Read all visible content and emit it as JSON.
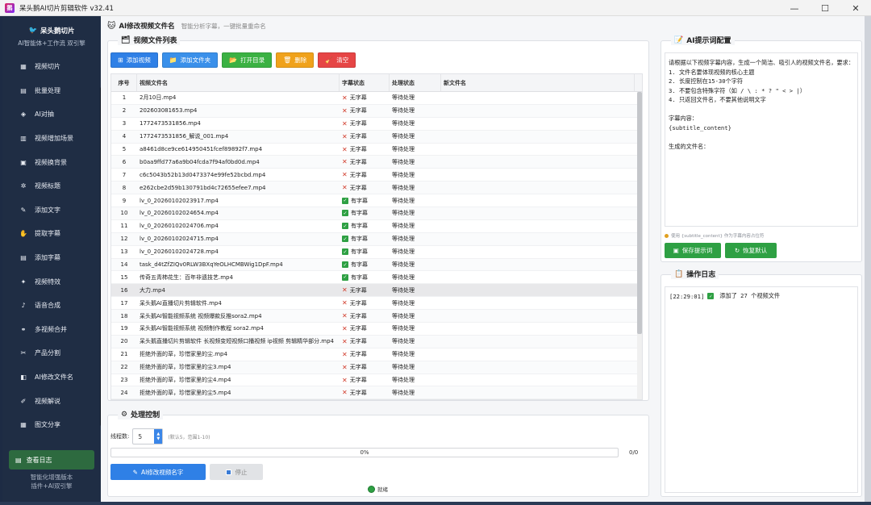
{
  "window": {
    "title": "呆头鹅AI切片剪辑软件 v32.41",
    "icon": "app-logo-icon",
    "minimize": "—",
    "maximize": "☐",
    "close": "✕"
  },
  "sidebar": {
    "brand_title": "呆头鹅切片",
    "brand_sub": "AI智能体+工作流 双引擎",
    "items": [
      {
        "label": "视频切片",
        "icon": "film-icon",
        "glyph": "▦"
      },
      {
        "label": "批量处理",
        "icon": "box-icon",
        "glyph": "▤"
      },
      {
        "label": "AI对抽",
        "icon": "ai-icon",
        "glyph": "◈"
      },
      {
        "label": "视频增加场景",
        "icon": "scene-icon",
        "glyph": "▥"
      },
      {
        "label": "视频换背景",
        "icon": "image-icon",
        "glyph": "▣"
      },
      {
        "label": "视频标题",
        "icon": "star-icon",
        "glyph": "✲"
      },
      {
        "label": "添加文字",
        "icon": "pen-icon",
        "glyph": "✎"
      },
      {
        "label": "提取字幕",
        "icon": "hand-icon",
        "glyph": "✋"
      },
      {
        "label": "添加字幕",
        "icon": "note-icon",
        "glyph": "▤"
      },
      {
        "label": "视频特效",
        "icon": "magic-icon",
        "glyph": "✦"
      },
      {
        "label": "语音合成",
        "icon": "mic-icon",
        "glyph": "♪"
      },
      {
        "label": "多视频合并",
        "icon": "link-icon",
        "glyph": "⚭"
      },
      {
        "label": "产品分割",
        "icon": "scissors-icon",
        "glyph": "✂"
      },
      {
        "label": "AI修改文件名",
        "icon": "rename-icon",
        "glyph": "◧"
      },
      {
        "label": "视频解说",
        "icon": "comment-icon",
        "glyph": "✐"
      },
      {
        "label": "图文分享",
        "icon": "share-icon",
        "glyph": "▦"
      }
    ],
    "log_button": "查看日志",
    "footer_line1": "智能化增强版本",
    "footer_line2": "插件+AI双引擎"
  },
  "header": {
    "title": "AI修改视频文件名",
    "subtitle": "智能分析字幕，一键批量重命名"
  },
  "files_panel": {
    "title": "视频文件列表",
    "buttons": {
      "add_video": "添加视频",
      "add_folder": "添加文件夹",
      "open_dir": "打开目录",
      "delete": "删除",
      "clear": "清空"
    },
    "columns": [
      "序号",
      "视频文件名",
      "字幕状态",
      "处理状态",
      "新文件名"
    ],
    "rows": [
      {
        "no": "1",
        "name": "2月10日.mp4",
        "sub": "无字幕",
        "has": false,
        "status": "等待处理"
      },
      {
        "no": "2",
        "name": "202603081653.mp4",
        "sub": "无字幕",
        "has": false,
        "status": "等待处理"
      },
      {
        "no": "3",
        "name": "1772473531856.mp4",
        "sub": "无字幕",
        "has": false,
        "status": "等待处理"
      },
      {
        "no": "4",
        "name": "1772473531856_解说_001.mp4",
        "sub": "无字幕",
        "has": false,
        "status": "等待处理"
      },
      {
        "no": "5",
        "name": "a8461d8ce9ce614950451fcef89892f7.mp4",
        "sub": "无字幕",
        "has": false,
        "status": "等待处理"
      },
      {
        "no": "6",
        "name": "b0aa9ffd77a6a9b04fcda7f94af0bd0d.mp4",
        "sub": "无字幕",
        "has": false,
        "status": "等待处理"
      },
      {
        "no": "7",
        "name": "c6c5043b52b13d0473374e99fe52bcbd.mp4",
        "sub": "无字幕",
        "has": false,
        "status": "等待处理"
      },
      {
        "no": "8",
        "name": "e262cbe2d59b130791bd4c72655efee7.mp4",
        "sub": "无字幕",
        "has": false,
        "status": "等待处理"
      },
      {
        "no": "9",
        "name": "lv_0_20260102023917.mp4",
        "sub": "有字幕",
        "has": true,
        "status": "等待处理"
      },
      {
        "no": "10",
        "name": "lv_0_20260102024654.mp4",
        "sub": "有字幕",
        "has": true,
        "status": "等待处理"
      },
      {
        "no": "11",
        "name": "lv_0_20260102024706.mp4",
        "sub": "有字幕",
        "has": true,
        "status": "等待处理"
      },
      {
        "no": "12",
        "name": "lv_0_20260102024715.mp4",
        "sub": "有字幕",
        "has": true,
        "status": "等待处理"
      },
      {
        "no": "13",
        "name": "lv_0_20260102024728.mp4",
        "sub": "有字幕",
        "has": true,
        "status": "等待处理"
      },
      {
        "no": "14",
        "name": "task_d4tZfZIQv0RLW3BXqYeOLHCMBWig1DpF.mp4",
        "sub": "有字幕",
        "has": true,
        "status": "等待处理"
      },
      {
        "no": "15",
        "name": "传奇五青柿花生：百年非遗技艺.mp4",
        "sub": "有字幕",
        "has": true,
        "status": "等待处理"
      },
      {
        "no": "16",
        "name": "大力.mp4",
        "sub": "无字幕",
        "has": false,
        "status": "等待处理"
      },
      {
        "no": "17",
        "name": "呆头鹅AI直播切片剪辑软件.mp4",
        "sub": "无字幕",
        "has": false,
        "status": "等待处理"
      },
      {
        "no": "18",
        "name": "呆头鹅AI智能视频系统 视频爆款反推sora2.mp4",
        "sub": "无字幕",
        "has": false,
        "status": "等待处理"
      },
      {
        "no": "19",
        "name": "呆头鹅AI智能视频系统 视频制作教程 sora2.mp4",
        "sub": "无字幕",
        "has": false,
        "status": "等待处理"
      },
      {
        "no": "20",
        "name": "呆头鹅直播切片剪辑软件 长视频变短视频口播视频 ip视频 剪辑精华部分.mp4",
        "sub": "无字幕",
        "has": false,
        "status": "等待处理"
      },
      {
        "no": "21",
        "name": "拒绝外面的草，珍惜家里的尘.mp4",
        "sub": "无字幕",
        "has": false,
        "status": "等待处理"
      },
      {
        "no": "22",
        "name": "拒绝外面的草，珍惜家里的尘3.mp4",
        "sub": "无字幕",
        "has": false,
        "status": "等待处理"
      },
      {
        "no": "23",
        "name": "拒绝外面的草，珍惜家里的尘4.mp4",
        "sub": "无字幕",
        "has": false,
        "status": "等待处理"
      },
      {
        "no": "24",
        "name": "拒绝外面的草，珍惜家里的尘5.mp4",
        "sub": "无字幕",
        "has": false,
        "status": "等待处理"
      }
    ]
  },
  "control_panel": {
    "title": "处理控制",
    "threads_label": "线程数:",
    "threads_value": "5",
    "threads_hint": "(默认5，范围1-10)",
    "progress_text": "0%",
    "progress_value": 0,
    "count": "0/0",
    "rename_button": "AI修改视频名字",
    "stop_button": "停止",
    "status": "就绪"
  },
  "prompt_panel": {
    "title": "AI提示词配置",
    "text": "请根据以下视频字幕内容，生成一个简洁、吸引人的视频文件名，要求：\n1. 文件名要体现视频的核心主题\n2. 长度控制在15-30个字符\n3. 不要包含特殊字符（如 / \\ : * ? \" < > |）\n4. 只返回文件名，不要其他说明文字\n\n字幕内容：\n{subtitle_content}\n\n生成的文件名：",
    "hint": "使用 {subtitle_content} 作为字幕内容占位符",
    "save_button": "保存提示词",
    "reset_button": "恢复默认"
  },
  "log_panel": {
    "title": "操作日志",
    "time": "[22:29:01]",
    "message": "添加了 27 个视频文件"
  }
}
